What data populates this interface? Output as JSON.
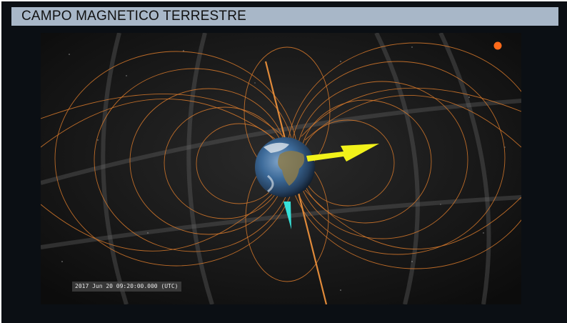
{
  "header": {
    "title": "CAMPO MAGNETICO TERRESTRE"
  },
  "viewer": {
    "timestamp": "2017 Jun 20 09:20:00.000 (UTC)",
    "icons": {
      "earth": "earth-globe-icon",
      "sun": "sun-marker-icon",
      "sun_direction": "yellow-arrow-icon",
      "magnetic_axis": "cyan-arrow-icon"
    }
  },
  "colors": {
    "title_bar": "#a8b7c8",
    "background": "#0b0f14",
    "field_lines": "#d97a2c",
    "sun": "#ff6a1a",
    "sun_arrow": "#f2f21a",
    "axis_arrow": "#37e0d8"
  }
}
